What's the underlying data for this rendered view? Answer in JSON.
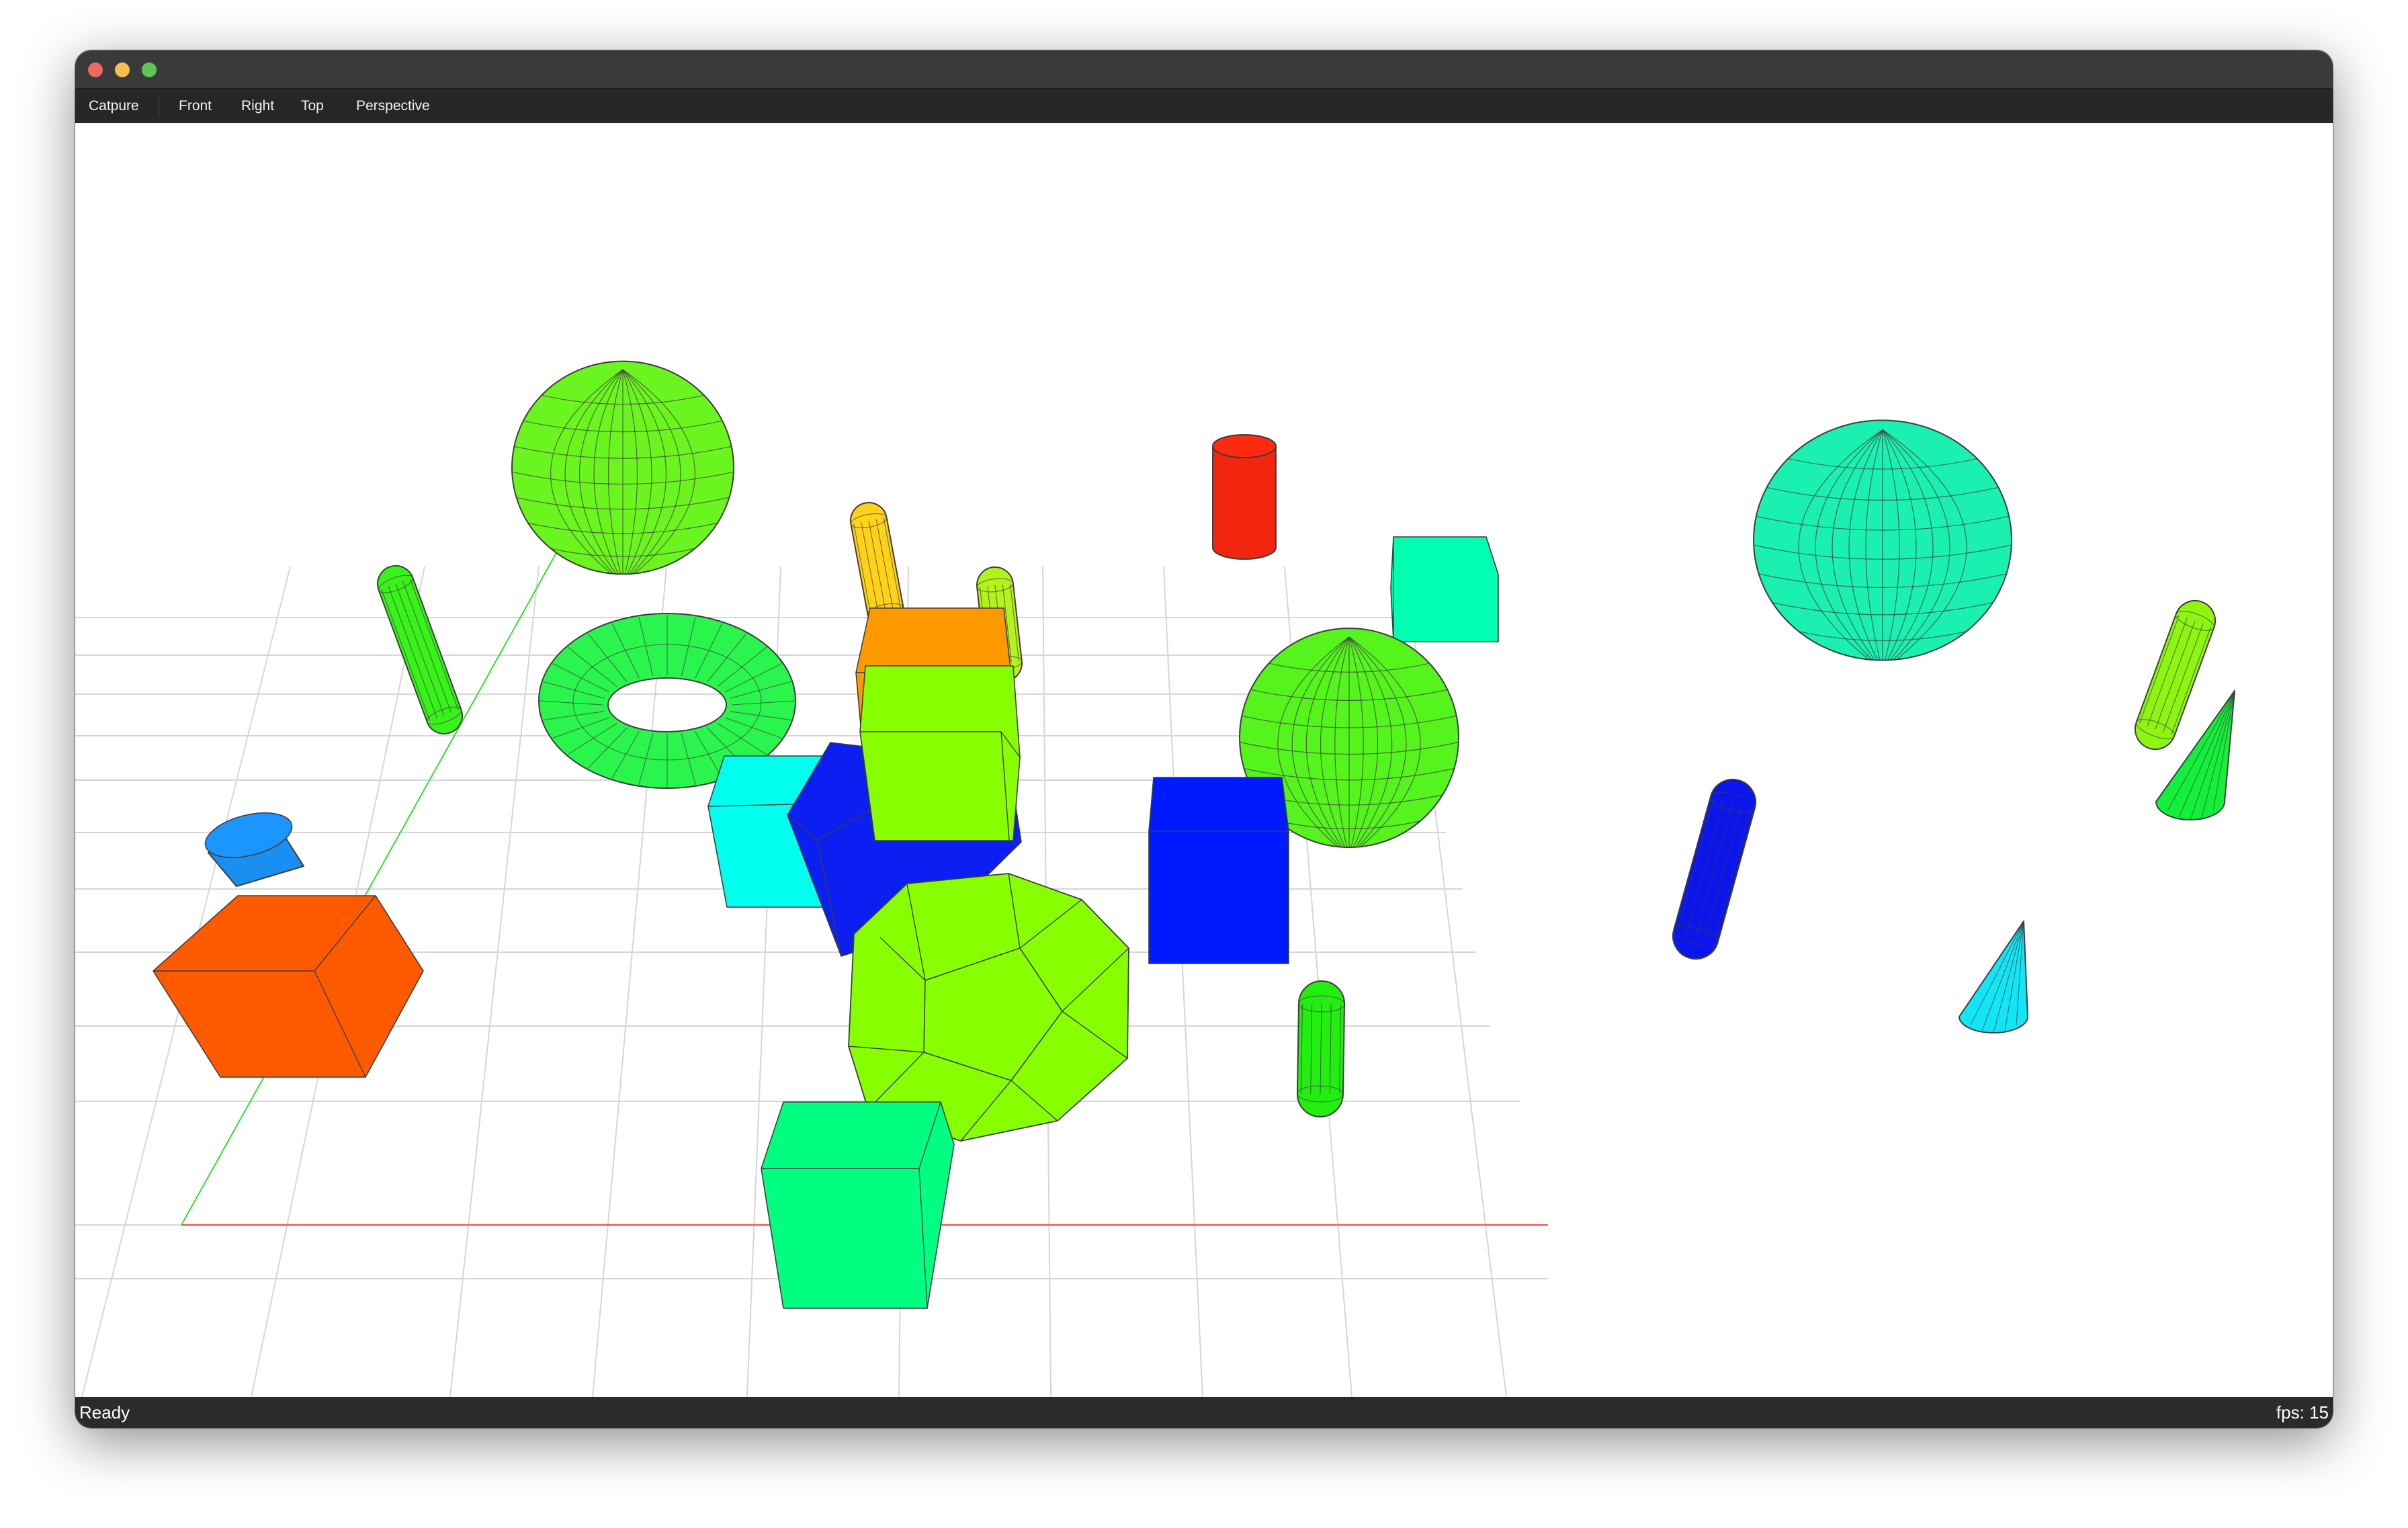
{
  "toolbar": {
    "capture_label": "Catpure",
    "views": [
      {
        "label": "Front"
      },
      {
        "label": "Right"
      },
      {
        "label": "Top"
      },
      {
        "label": "Perspective"
      }
    ]
  },
  "status": {
    "text": "Ready",
    "fps_label": "fps:",
    "fps_value": "15"
  },
  "scene": {
    "background": "#ffffff",
    "grid_color": "#d6d6d6",
    "x_axis_color": "#ff4444",
    "z_axis_color": "#33dd33",
    "objects": [
      {
        "type": "sphere",
        "color": "#6bf51f"
      },
      {
        "type": "capsule",
        "color": "#38f21a"
      },
      {
        "type": "capsule",
        "color": "#ffd21a"
      },
      {
        "type": "capsule",
        "color": "#b3f21a"
      },
      {
        "type": "cylinder",
        "color": "#f2260f"
      },
      {
        "type": "cube",
        "color": "#00ffb0"
      },
      {
        "type": "sphere",
        "color": "#1af0b0"
      },
      {
        "type": "capsule",
        "color": "#8df510"
      },
      {
        "type": "cone",
        "color": "#12f03a"
      },
      {
        "type": "torus",
        "color": "#2af54d"
      },
      {
        "type": "cube",
        "color": "#ff9900"
      },
      {
        "type": "cube",
        "color": "#00ffee"
      },
      {
        "type": "cube",
        "color": "#0b1ff2"
      },
      {
        "type": "cube",
        "color": "#88ff00"
      },
      {
        "type": "sphere",
        "color": "#55f41c"
      },
      {
        "type": "cube",
        "color": "#001aff"
      },
      {
        "type": "capsule",
        "color": "#0b16ee"
      },
      {
        "type": "cone",
        "color": "#12e5f5"
      },
      {
        "type": "cylinder",
        "color": "#1a8ff2"
      },
      {
        "type": "cube",
        "color": "#ff5a00"
      },
      {
        "type": "dodecahedron",
        "color": "#88ff00"
      },
      {
        "type": "capsule",
        "color": "#22ee10"
      },
      {
        "type": "cube",
        "color": "#00ff80"
      }
    ]
  }
}
